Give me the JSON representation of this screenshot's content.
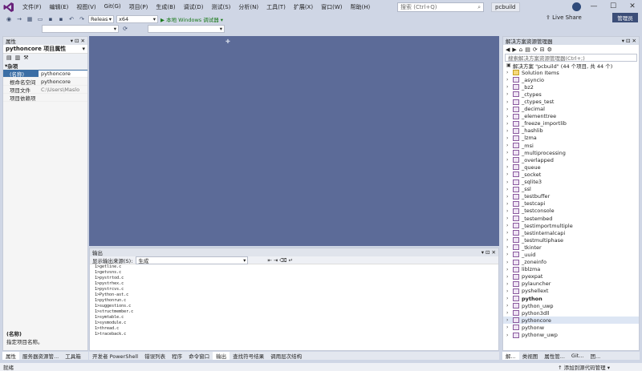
{
  "menu": [
    "文件(F)",
    "编辑(E)",
    "视图(V)",
    "Git(G)",
    "项目(P)",
    "生成(B)",
    "调试(D)",
    "测试(S)",
    "分析(N)",
    "工具(T)",
    "扩展(X)",
    "窗口(W)",
    "帮助(H)"
  ],
  "search": {
    "placeholder": "搜索 (Ctrl+Q)"
  },
  "solution_name": "pcbuild",
  "live_share": "Live Share",
  "admin_label": "管理员",
  "toolbar": {
    "config": "Releas",
    "platform": "x64",
    "run_label": "▶ 本地 Windows 调试器 ▾"
  },
  "properties": {
    "title": "属性",
    "object": "pythoncore 项目属性",
    "section": "杂项",
    "rows": [
      {
        "k": "(名称)",
        "v": "pythoncore"
      },
      {
        "k": "根命名空间",
        "v": "pythoncore"
      },
      {
        "k": "项目文件",
        "v": "C:\\Users\\Maslo"
      },
      {
        "k": "项目依赖项",
        "v": ""
      }
    ],
    "desc_title": "(名称)",
    "desc_text": "指定项目名称。"
  },
  "output": {
    "title": "输出",
    "source_label": "显示输出来源(S):",
    "source_value": "生成",
    "lines": [
      "1>getline.c",
      "1>getvsns.c",
      "1>pystrtod.c",
      "1>pystrhex.c",
      "1>pystrcvs.c",
      "1>Python-ast.c",
      "1>pythonrun.c",
      "1>suggestions.c",
      "1>structmember.c",
      "1>symtable.c",
      "1>sysmodule.c",
      "1>thread.c",
      "1>traceback.c"
    ]
  },
  "solution_explorer": {
    "title": "解决方案资源管理器",
    "search_placeholder": "搜索解决方案资源管理器(Ctrl+;)",
    "root": "解决方案 \"pcbuild\" (44 个项目, 共 44 个)",
    "items": [
      "Solution Items",
      "_asyncio",
      "_bz2",
      "_ctypes",
      "_ctypes_test",
      "_decimal",
      "_elementtree",
      "_freeze_importlib",
      "_hashlib",
      "_lzma",
      "_msi",
      "_multiprocessing",
      "_overlapped",
      "_queue",
      "_socket",
      "_sqlite3",
      "_ssl",
      "_testbuffer",
      "_testcapi",
      "_testconsole",
      "_testembed",
      "_testimportmultiple",
      "_testinternalcapi",
      "_testmultiphase",
      "_tkinter",
      "_uuid",
      "_zoneinfo",
      "liblzma",
      "pyexpat",
      "pylauncher",
      "pyshellext",
      "python",
      "python_uwp",
      "python3dll",
      "pythoncore",
      "pythonw",
      "pythonw_uwp"
    ],
    "bold_item": "python"
  },
  "left_bottom_tabs": [
    "属性",
    "服务器资源管...",
    "工具箱"
  ],
  "output_bottom_tabs": [
    "开发者 PowerShell",
    "错误列表",
    "程序",
    "命令窗口",
    "输出",
    "查找符号结果",
    "调用层次结构"
  ],
  "se_bottom_tabs": [
    "解...",
    "类视图",
    "属性管...",
    "Git...",
    "团..."
  ],
  "status": {
    "left": "就绪",
    "right": "↑ 添加到源代码管理 ▾"
  }
}
